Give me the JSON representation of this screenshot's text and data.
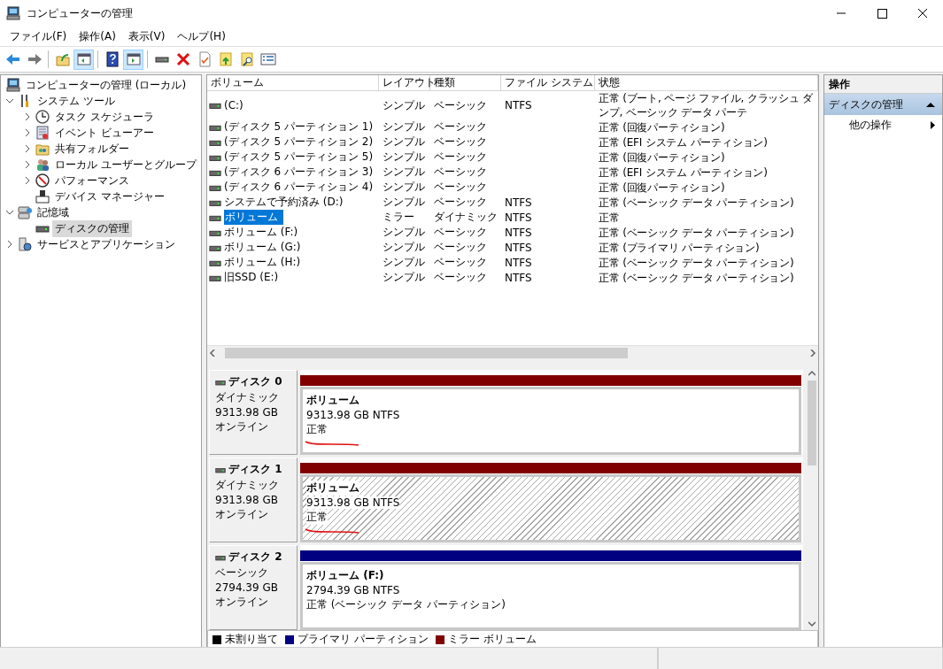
{
  "window": {
    "title": "コンピューターの管理"
  },
  "menu": [
    "ファイル(F)",
    "操作(A)",
    "表示(V)",
    "ヘルプ(H)"
  ],
  "toolbar": [
    {
      "kind": "back",
      "pressed": false
    },
    {
      "kind": "forward",
      "pressed": false
    },
    {
      "kind": "sep"
    },
    {
      "kind": "upfolder",
      "pressed": false
    },
    {
      "kind": "pane",
      "pressed": true
    },
    {
      "kind": "sep"
    },
    {
      "kind": "help",
      "pressed": false
    },
    {
      "kind": "pane2",
      "pressed": true
    },
    {
      "kind": "sep"
    },
    {
      "kind": "drive",
      "pressed": false
    },
    {
      "kind": "delete",
      "pressed": false
    },
    {
      "kind": "props",
      "pressed": false
    },
    {
      "kind": "export",
      "pressed": false
    },
    {
      "kind": "find",
      "pressed": false
    },
    {
      "kind": "list",
      "pressed": false
    }
  ],
  "tree": [
    {
      "label": "コンピューターの管理 (ローカル)",
      "kind": "computer",
      "selected": false,
      "children": [
        {
          "label": "システム ツール",
          "kind": "tools",
          "selected": false,
          "expanded": true,
          "children": [
            {
              "label": "タスク スケジューラ",
              "kind": "clock",
              "selected": false,
              "expanded": false
            },
            {
              "label": "イベント ビューアー",
              "kind": "event",
              "selected": false,
              "expanded": false
            },
            {
              "label": "共有フォルダー",
              "kind": "share",
              "selected": false,
              "expanded": false
            },
            {
              "label": "ローカル ユーザーとグループ",
              "kind": "users",
              "selected": false,
              "expanded": false
            },
            {
              "label": "パフォーマンス",
              "kind": "perf",
              "selected": false,
              "expanded": false
            },
            {
              "label": "デバイス マネージャー",
              "kind": "device",
              "selected": false
            }
          ]
        },
        {
          "label": "記憶域",
          "kind": "storage",
          "selected": false,
          "expanded": true,
          "children": [
            {
              "label": "ディスクの管理",
              "kind": "disk",
              "selected": true
            }
          ]
        },
        {
          "label": "サービスとアプリケーション",
          "kind": "services",
          "selected": false,
          "expanded": false
        }
      ]
    }
  ],
  "volumes": {
    "columns": [
      "ボリューム",
      "レイアウト",
      "種類",
      "ファイル システム",
      "状態"
    ],
    "rows": [
      {
        "selected": false,
        "cells": [
          " (C:)",
          "シンプル",
          "ベーシック",
          "NTFS",
          "正常 (ブート, ページ ファイル, クラッシュ ダンプ, ベーシック データ パーテ"
        ]
      },
      {
        "selected": false,
        "cells": [
          "(ディスク 5 パーティション 1)",
          "シンプル",
          "ベーシック",
          "",
          "正常 (回復パーティション)"
        ]
      },
      {
        "selected": false,
        "cells": [
          "(ディスク 5 パーティション 2)",
          "シンプル",
          "ベーシック",
          "",
          "正常 (EFI システム パーティション)"
        ]
      },
      {
        "selected": false,
        "cells": [
          "(ディスク 5 パーティション 5)",
          "シンプル",
          "ベーシック",
          "",
          "正常 (回復パーティション)"
        ]
      },
      {
        "selected": false,
        "cells": [
          "(ディスク 6 パーティション 3)",
          "シンプル",
          "ベーシック",
          "",
          "正常 (EFI システム パーティション)"
        ]
      },
      {
        "selected": false,
        "cells": [
          "(ディスク 6 パーティション 4)",
          "シンプル",
          "ベーシック",
          "",
          "正常 (回復パーティション)"
        ]
      },
      {
        "selected": false,
        "cells": [
          "システムで予約済み (D:)",
          "シンプル",
          "ベーシック",
          "NTFS",
          "正常 (ベーシック データ パーティション)"
        ]
      },
      {
        "selected": true,
        "cells": [
          "ボリューム",
          "ミラー",
          "ダイナミック",
          "NTFS",
          "正常"
        ]
      },
      {
        "selected": false,
        "cells": [
          "ボリューム (F:)",
          "シンプル",
          "ベーシック",
          "NTFS",
          "正常 (ベーシック データ パーティション)"
        ]
      },
      {
        "selected": false,
        "cells": [
          "ボリューム (G:)",
          "シンプル",
          "ベーシック",
          "NTFS",
          "正常 (プライマリ パーティション)"
        ]
      },
      {
        "selected": false,
        "cells": [
          "ボリューム (H:)",
          "シンプル",
          "ベーシック",
          "NTFS",
          "正常 (ベーシック データ パーティション)"
        ]
      },
      {
        "selected": false,
        "cells": [
          "旧SSD (E:)",
          "シンプル",
          "ベーシック",
          "NTFS",
          "正常 (ベーシック データ パーティション)"
        ]
      }
    ]
  },
  "disks": [
    {
      "name": "ディスク 0",
      "type": "ダイナミック",
      "size": "9313.98 GB",
      "status": "オンライン",
      "partitions": [
        {
          "name": "ボリューム",
          "detail": "9313.98 GB NTFS",
          "status": "正常",
          "color": "#800000",
          "hatched": false,
          "marked": true
        }
      ]
    },
    {
      "name": "ディスク 1",
      "type": "ダイナミック",
      "size": "9313.98 GB",
      "status": "オンライン",
      "partitions": [
        {
          "name": "ボリューム",
          "detail": "9313.98 GB NTFS",
          "status": "正常",
          "color": "#800000",
          "hatched": true,
          "marked": true
        }
      ]
    },
    {
      "name": "ディスク 2",
      "type": "ベーシック",
      "size": "2794.39 GB",
      "status": "オンライン",
      "partitions": [
        {
          "name": "ボリューム  (F:)",
          "detail": "2794.39 GB NTFS",
          "status": "正常 (ベーシック データ パーティション)",
          "color": "#000080",
          "hatched": false,
          "marked": false
        }
      ]
    }
  ],
  "legend": [
    {
      "label": "未割り当て",
      "color": "#000000"
    },
    {
      "label": "プライマリ パーティション",
      "color": "#000080"
    },
    {
      "label": "ミラー ボリューム",
      "color": "#800000"
    }
  ],
  "actions": {
    "title": "操作",
    "section": {
      "label": "ディスクの管理",
      "expanded": true
    },
    "items": [
      "他の操作"
    ]
  }
}
